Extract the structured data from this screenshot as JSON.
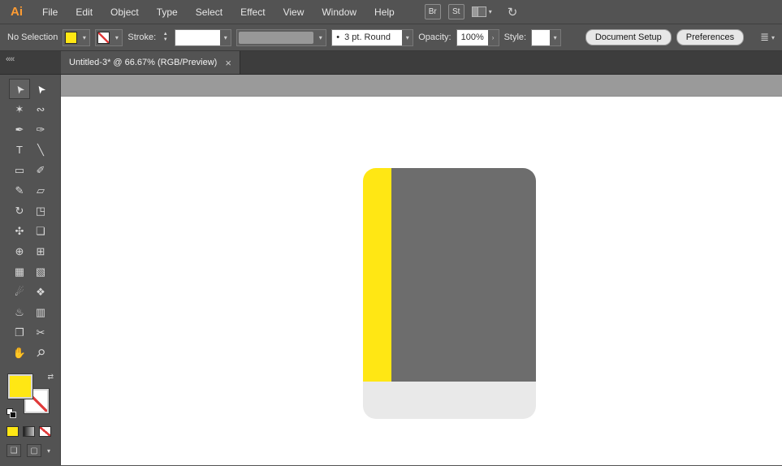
{
  "app": {
    "logo_text": "Ai"
  },
  "colors": {
    "accent_yellow": "#ffe714",
    "chrome_gray": "#535353",
    "tab_bar_gray": "#3d3d3d",
    "pasteboard_gray": "#9a9a9a",
    "book_cover_gray": "#6d6d6d",
    "book_pages_gray": "#e9e9e9",
    "none_red": "#e03a3a"
  },
  "icons": {
    "chevron_down": "▾",
    "chevron_right": "›",
    "stepper_up": "▲",
    "stepper_down": "▼",
    "swap": "⇄",
    "align": "≣",
    "sync": "↻",
    "close": "×"
  },
  "menubar": {
    "items": [
      "File",
      "Edit",
      "Object",
      "Type",
      "Select",
      "Effect",
      "View",
      "Window",
      "Help"
    ],
    "bridge_label": "Br",
    "stock_label": "St"
  },
  "controlbar": {
    "selection_label": "No Selection",
    "stroke_label": "Stroke:",
    "stroke_width_value": "",
    "brush_bullet": "•",
    "brush_value": "3 pt. Round",
    "opacity_label": "Opacity:",
    "opacity_value": "100%",
    "style_label": "Style:",
    "document_setup_label": "Document Setup",
    "preferences_label": "Preferences"
  },
  "document_tab": {
    "title": "Untitled-3* @ 66.67% (RGB/Preview)"
  },
  "toolbar": {
    "collapse_label": "««",
    "tools": [
      {
        "name": "selection",
        "glyph": "➤"
      },
      {
        "name": "direct-selection",
        "glyph": "➤"
      },
      {
        "name": "magic-wand",
        "glyph": "✶"
      },
      {
        "name": "lasso",
        "glyph": "∾"
      },
      {
        "name": "pen",
        "glyph": "✒"
      },
      {
        "name": "curvature",
        "glyph": "✑"
      },
      {
        "name": "type",
        "glyph": "T"
      },
      {
        "name": "line-segment",
        "glyph": "╲"
      },
      {
        "name": "rectangle",
        "glyph": "▭"
      },
      {
        "name": "paintbrush",
        "glyph": "✐"
      },
      {
        "name": "pencil",
        "glyph": "✎"
      },
      {
        "name": "eraser",
        "glyph": "▱"
      },
      {
        "name": "rotate",
        "glyph": "↻"
      },
      {
        "name": "scale",
        "glyph": "◳"
      },
      {
        "name": "width",
        "glyph": "✣"
      },
      {
        "name": "free-transform",
        "glyph": "❏"
      },
      {
        "name": "shape-builder",
        "glyph": "⊕"
      },
      {
        "name": "perspective-grid",
        "glyph": "⊞"
      },
      {
        "name": "mesh",
        "glyph": "▦"
      },
      {
        "name": "gradient",
        "glyph": "▧"
      },
      {
        "name": "eyedropper",
        "glyph": "☄"
      },
      {
        "name": "blend",
        "glyph": "❖"
      },
      {
        "name": "symbol-sprayer",
        "glyph": "♨"
      },
      {
        "name": "column-graph",
        "glyph": "▥"
      },
      {
        "name": "artboard",
        "glyph": "❐"
      },
      {
        "name": "slice",
        "glyph": "✂"
      },
      {
        "name": "hand",
        "glyph": "✋"
      },
      {
        "name": "zoom",
        "glyph": "⚲"
      }
    ]
  },
  "canvas": {
    "artwork": {
      "spine_color": "#ffe714",
      "cover_color": "#6d6d6d",
      "pages_color": "#e9e9e9"
    }
  }
}
